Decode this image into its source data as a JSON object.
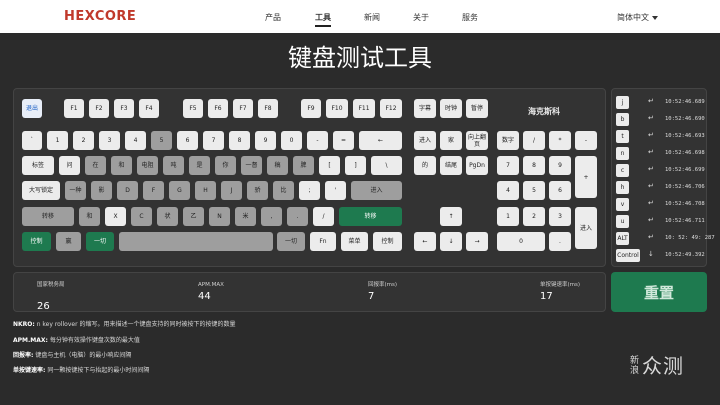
{
  "nav": {
    "logo": "HEXCORE",
    "items": [
      "产品",
      "工具",
      "新闻",
      "关于",
      "服务"
    ],
    "language": "简体中文"
  },
  "page_title": "键盘测试工具",
  "keyboard": {
    "brand_label": "海克斯科",
    "rows": {
      "fn": [
        "退出",
        "F1",
        "F2",
        "F3",
        "F4",
        "F5",
        "F6",
        "F7",
        "F8",
        "F9",
        "F10",
        "F11",
        "F12",
        "字幕",
        "时钟",
        "暂停"
      ],
      "num": [
        "`",
        "1",
        "2",
        "3",
        "4",
        "5",
        "6",
        "7",
        "8",
        "9",
        "0",
        "-",
        "=",
        "←",
        "进入",
        "家",
        "向上翻页",
        "数字",
        "/",
        "*",
        "-"
      ],
      "tab": [
        "标签",
        "问",
        "在",
        "和",
        "电阻",
        "吨",
        "是",
        "你",
        "一督",
        "稿",
        "脾",
        "[",
        "]",
        "\\",
        "的",
        "结尾",
        "PgDn",
        "7",
        "8",
        "9",
        "+"
      ],
      "caps": [
        "大写锁定",
        "一种",
        "影",
        "D",
        "F",
        "G",
        "H",
        "J",
        "骄",
        "比",
        ";",
        "'",
        "进入",
        "4",
        "5",
        "6"
      ],
      "shift": [
        "转移",
        "和",
        "X",
        "C",
        "状",
        "乙",
        "N",
        "米",
        ",",
        ".",
        "/",
        "转移",
        "↑",
        "1",
        "2",
        "3",
        "进入"
      ],
      "bottom": [
        "控制",
        "赢",
        "一切",
        "一切",
        "Fn",
        "菜单",
        "控制",
        "←",
        "↓",
        "→",
        "0",
        "."
      ]
    }
  },
  "key_log": [
    {
      "key": "j",
      "time": "10:52:46.689"
    },
    {
      "key": "b",
      "time": "10:52:46.690"
    },
    {
      "key": "t",
      "time": "10:52:46.693"
    },
    {
      "key": "n",
      "time": "10:52:46.698"
    },
    {
      "key": "c",
      "time": "10:52:46.699"
    },
    {
      "key": "h",
      "time": "10:52:46.706"
    },
    {
      "key": "v",
      "time": "10:52:46.708"
    },
    {
      "key": "u",
      "time": "10:52:46.711"
    },
    {
      "key": "ALT",
      "time": "10:  52:  49:  287"
    },
    {
      "key": "Control",
      "time": "10:52:49.392"
    }
  ],
  "stats": [
    {
      "label": "国家税务局",
      "value": "26"
    },
    {
      "label": "APM.MAX",
      "value": "44"
    },
    {
      "label": "回报率(ms)",
      "value": "7"
    },
    {
      "label": "单按键速率(ms)",
      "value": "17"
    }
  ],
  "reset_label": "重置",
  "notes": [
    {
      "term": "NKRO:",
      "text": " n key rollover 的缩写。用来描述一个键盘支持的同时被按下的按键的数量"
    },
    {
      "term": "APM.MAX:",
      "text": " 每分钟有效操作键盘次数的最大值"
    },
    {
      "term": "回报率:",
      "text": " 键盘与主机（电脑）的最小响应间隔"
    },
    {
      "term": "单按键速率:",
      "text": " 同一颗按键按下与抬起的最小时间间隔"
    }
  ],
  "watermark": {
    "small": "新浪",
    "big": "众测"
  },
  "colors": {
    "accent_green": "#1e7a4f",
    "brand_red": "#c0392b",
    "background": "#2b2b2b"
  }
}
